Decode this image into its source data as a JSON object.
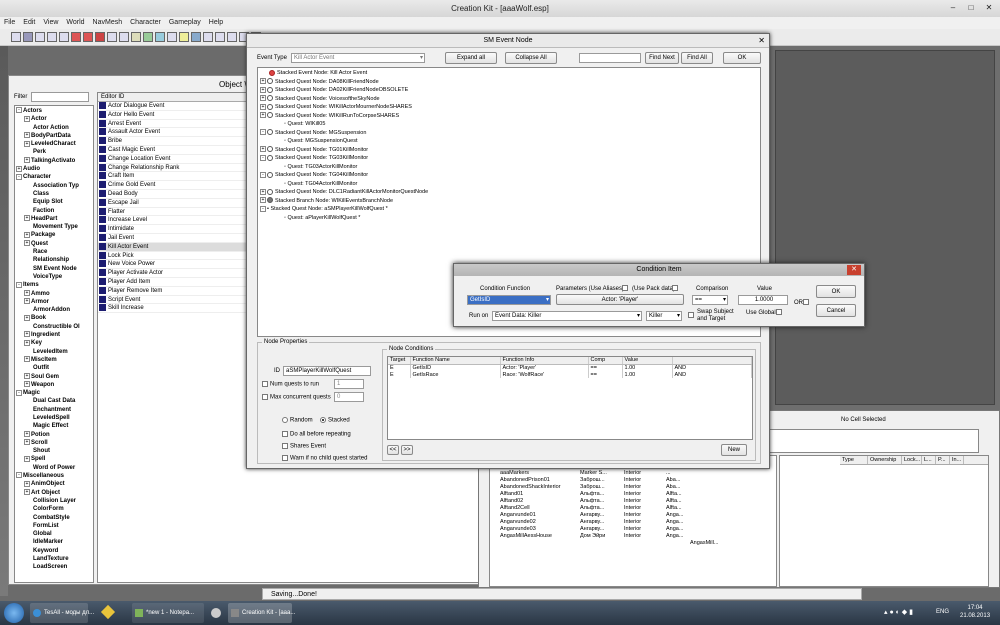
{
  "app": {
    "title": "Creation Kit - [aaaWolf.esp]"
  },
  "menu": [
    "File",
    "Edit",
    "View",
    "World",
    "NavMesh",
    "Character",
    "Gameplay",
    "Help"
  ],
  "object_window": {
    "title": "Object W",
    "filter_label": "Filter",
    "editor_id_header": "Editor ID",
    "tree": [
      {
        "label": "Actors",
        "exp": "-",
        "indent": 0,
        "bold": true
      },
      {
        "label": "Actor",
        "exp": "+",
        "indent": 1,
        "bold": true
      },
      {
        "label": "Actor Action",
        "exp": "",
        "indent": 1,
        "bold": true
      },
      {
        "label": "BodyPartData",
        "exp": "+",
        "indent": 1,
        "bold": true
      },
      {
        "label": "LeveledCharact",
        "exp": "+",
        "indent": 1,
        "bold": true
      },
      {
        "label": "Perk",
        "exp": "",
        "indent": 1,
        "bold": true
      },
      {
        "label": "TalkingActivato",
        "exp": "+",
        "indent": 1,
        "bold": true
      },
      {
        "label": "Audio",
        "exp": "+",
        "indent": 0,
        "bold": true
      },
      {
        "label": "Character",
        "exp": "-",
        "indent": 0,
        "bold": true
      },
      {
        "label": "Association Typ",
        "exp": "",
        "indent": 1,
        "bold": true
      },
      {
        "label": "Class",
        "exp": "",
        "indent": 1,
        "bold": true
      },
      {
        "label": "Equip Slot",
        "exp": "",
        "indent": 1,
        "bold": true
      },
      {
        "label": "Faction",
        "exp": "",
        "indent": 1,
        "bold": true
      },
      {
        "label": "HeadPart",
        "exp": "+",
        "indent": 1,
        "bold": true
      },
      {
        "label": "Movement Type",
        "exp": "",
        "indent": 1,
        "bold": true
      },
      {
        "label": "Package",
        "exp": "+",
        "indent": 1,
        "bold": true
      },
      {
        "label": "Quest",
        "exp": "+",
        "indent": 1,
        "bold": true
      },
      {
        "label": "Race",
        "exp": "",
        "indent": 1,
        "bold": true
      },
      {
        "label": "Relationship",
        "exp": "",
        "indent": 1,
        "bold": true
      },
      {
        "label": "SM Event Node",
        "exp": "",
        "indent": 1,
        "bold": true
      },
      {
        "label": "VoiceType",
        "exp": "",
        "indent": 1,
        "bold": true
      },
      {
        "label": "Items",
        "exp": "-",
        "indent": 0,
        "bold": true
      },
      {
        "label": "Ammo",
        "exp": "+",
        "indent": 1,
        "bold": true
      },
      {
        "label": "Armor",
        "exp": "+",
        "indent": 1,
        "bold": true
      },
      {
        "label": "ArmorAddon",
        "exp": "",
        "indent": 1,
        "bold": true
      },
      {
        "label": "Book",
        "exp": "+",
        "indent": 1,
        "bold": true
      },
      {
        "label": "Constructible Ol",
        "exp": "",
        "indent": 1,
        "bold": true
      },
      {
        "label": "Ingredient",
        "exp": "+",
        "indent": 1,
        "bold": true
      },
      {
        "label": "Key",
        "exp": "+",
        "indent": 1,
        "bold": true
      },
      {
        "label": "LeveledItem",
        "exp": "",
        "indent": 1,
        "bold": true
      },
      {
        "label": "MiscItem",
        "exp": "+",
        "indent": 1,
        "bold": true
      },
      {
        "label": "Outfit",
        "exp": "",
        "indent": 1,
        "bold": true
      },
      {
        "label": "Soul Gem",
        "exp": "+",
        "indent": 1,
        "bold": true
      },
      {
        "label": "Weapon",
        "exp": "+",
        "indent": 1,
        "bold": true
      },
      {
        "label": "Magic",
        "exp": "-",
        "indent": 0,
        "bold": true
      },
      {
        "label": "Dual Cast Data",
        "exp": "",
        "indent": 1,
        "bold": true
      },
      {
        "label": "Enchantment",
        "exp": "",
        "indent": 1,
        "bold": true
      },
      {
        "label": "LeveledSpell",
        "exp": "",
        "indent": 1,
        "bold": true
      },
      {
        "label": "Magic Effect",
        "exp": "",
        "indent": 1,
        "bold": true
      },
      {
        "label": "Potion",
        "exp": "+",
        "indent": 1,
        "bold": true
      },
      {
        "label": "Scroll",
        "exp": "+",
        "indent": 1,
        "bold": true
      },
      {
        "label": "Shout",
        "exp": "",
        "indent": 1,
        "bold": true
      },
      {
        "label": "Spell",
        "exp": "+",
        "indent": 1,
        "bold": true
      },
      {
        "label": "Word of Power",
        "exp": "",
        "indent": 1,
        "bold": true
      },
      {
        "label": "Miscellaneous",
        "exp": "-",
        "indent": 0,
        "bold": true
      },
      {
        "label": "AnimObject",
        "exp": "+",
        "indent": 1,
        "bold": true
      },
      {
        "label": "Art Object",
        "exp": "+",
        "indent": 1,
        "bold": true
      },
      {
        "label": "Collision Layer",
        "exp": "",
        "indent": 1,
        "bold": true
      },
      {
        "label": "ColorForm",
        "exp": "",
        "indent": 1,
        "bold": true
      },
      {
        "label": "CombatStyle",
        "exp": "",
        "indent": 1,
        "bold": true
      },
      {
        "label": "FormList",
        "exp": "",
        "indent": 1,
        "bold": true
      },
      {
        "label": "Global",
        "exp": "",
        "indent": 1,
        "bold": true
      },
      {
        "label": "IdleMarker",
        "exp": "",
        "indent": 1,
        "bold": true
      },
      {
        "label": "Keyword",
        "exp": "",
        "indent": 1,
        "bold": true
      },
      {
        "label": "LandTexture",
        "exp": "",
        "indent": 1,
        "bold": true
      },
      {
        "label": "LoadScreen",
        "exp": "",
        "indent": 1,
        "bold": true
      }
    ],
    "items": [
      "Actor Dialogue Event",
      "Actor Hello Event",
      "Arrest Event",
      "Assault Actor Event",
      "Bribe",
      "Cast Magic Event",
      "Change Location Event",
      "Change Relationship Rank",
      "Craft Item",
      "Crime Gold Event",
      "Dead Body",
      "Escape Jail",
      "Flatter",
      "Increase Level",
      "Intimidate",
      "Jail Event",
      "Kill Actor Event",
      "Lock Pick",
      "New Voice Power",
      "Player Activate Actor",
      "Player Add Item",
      "Player Remove Item",
      "Script Event",
      "Skill Increase"
    ],
    "selected_item": "Kill Actor Event"
  },
  "sm_event": {
    "title": "SM Event Node",
    "event_type_label": "Event Type",
    "event_type_value": "Kill Actor Event",
    "expand_all": "Expand all",
    "collapse_all": "Collapse All",
    "find_next": "Find Next",
    "find_all": "Find All",
    "ok": "OK",
    "tree": [
      {
        "text": "Stacked Event Node: Kill Actor Event",
        "indent": 0,
        "exp": "",
        "dot": "r"
      },
      {
        "text": "Stacked Quest Node: DA08KillFriendNode",
        "indent": 0,
        "exp": "+",
        "dot": ""
      },
      {
        "text": "Stacked Quest Node: DA02KillFriendNodeOBSOLETE",
        "indent": 0,
        "exp": "+",
        "dot": ""
      },
      {
        "text": "Stacked Quest Node: VoicesoftheSkyNode",
        "indent": 0,
        "exp": "+",
        "dot": ""
      },
      {
        "text": "Stacked Quest Node: WIKillActorMournerNodeSHARES",
        "indent": 0,
        "exp": "+",
        "dot": ""
      },
      {
        "text": "Stacked Quest Node: WIKillRunToCorpseSHARES",
        "indent": 0,
        "exp": "+",
        "dot": ""
      },
      {
        "text": "Quest: WIKill05",
        "indent": 2,
        "exp": "",
        "dot": "q"
      },
      {
        "text": "Stacked Quest Node: MGSuspension",
        "indent": 0,
        "exp": "-",
        "dot": ""
      },
      {
        "text": "Quest: MGSuspensionQuest",
        "indent": 2,
        "exp": "",
        "dot": "q"
      },
      {
        "text": "Stacked Quest Node: TG01KillMonitor",
        "indent": 0,
        "exp": "+",
        "dot": ""
      },
      {
        "text": "Stacked Quest Node: TG03KillMonitor",
        "indent": 0,
        "exp": "-",
        "dot": ""
      },
      {
        "text": "Quest: TG03ActorKillMonitor",
        "indent": 2,
        "exp": "",
        "dot": "q"
      },
      {
        "text": "Stacked Quest Node: TG04KillMonitor",
        "indent": 0,
        "exp": "-",
        "dot": ""
      },
      {
        "text": "Quest: TG04ActorKillMonitor",
        "indent": 2,
        "exp": "",
        "dot": "q"
      },
      {
        "text": "Stacked Quest Node: DLC1RadiantKillActorMonitorQuestNode",
        "indent": 0,
        "exp": "+",
        "dot": ""
      },
      {
        "text": "Stacked Branch Node: WIKillEventsBranchNode",
        "indent": 0,
        "exp": "+",
        "dot": "f"
      },
      {
        "text": "Stacked Quest Node: aSMPlayerKillWolfQuest *",
        "indent": 0,
        "exp": "-",
        "dot": "s"
      },
      {
        "text": "Quest: aPlayerKillWolfQuest *",
        "indent": 2,
        "exp": "",
        "dot": "q"
      }
    ],
    "node_properties": {
      "title": "Node Properties",
      "id_label": "ID",
      "id_value": "aSMPlayerKillWolfQuest",
      "num_quests_label": "Num quests to run",
      "num_quests_value": "1",
      "max_concurrent_label": "Max concurrent quests",
      "max_concurrent_value": "0",
      "random_label": "Random",
      "stacked_label": "Stacked",
      "do_all_label": "Do all before repeating",
      "shares_label": "Shares Event",
      "warn_label": "Warn if no child quest started"
    },
    "node_conditions": {
      "title": "Node Conditions",
      "headers": [
        "Target",
        "Function Name",
        "Function Info",
        "Comp",
        "Value",
        ""
      ],
      "rows": [
        [
          "E",
          "GetIsID",
          "Actor: 'Player'",
          "==",
          "1.00",
          "AND"
        ],
        [
          "E",
          "GetIsRace",
          "Race: 'WolfRace'",
          "==",
          "1.00",
          "AND"
        ]
      ],
      "prev": "<<",
      "next": ">>",
      "new": "New"
    }
  },
  "condition": {
    "title": "Condition Item",
    "condition_function_label": "Condition Function",
    "function_value": "GetIsID",
    "parameters_label": "Parameters  (Use Aliases)",
    "use_pack_label": "(Use Pack data)",
    "actor_button": "Actor: 'Player'",
    "comparison_label": "Comparison",
    "comparison_value": "==",
    "value_label": "Value",
    "value": "1.0000",
    "or_label": "OR",
    "run_on_label": "Run on",
    "run_on_value": "Event Data: Killer",
    "killer_value": "Killer",
    "swap_label": "Swap Subject\nand Target",
    "use_global_label": "Use Global",
    "ok": "OK",
    "cancel": "Cancel"
  },
  "cell_view": {
    "no_cell": "No Cell Selected",
    "headers": [
      "Type",
      "Ownership",
      "Lock...",
      "L...",
      "P...",
      "In..."
    ]
  },
  "cells": [
    [
      "aaaMarkers",
      "Marker S...",
      "Interior",
      "..."
    ],
    [
      "AbandonedPrison01",
      "Заброш...",
      "Interior",
      "Aba..."
    ],
    [
      "AbandonedShackInterior",
      "Заброш...",
      "Interior",
      "Aba..."
    ],
    [
      "Alftand01",
      "Альфта...",
      "Interior",
      "Alfta..."
    ],
    [
      "Alftand02",
      "Альфта...",
      "Interior",
      "Alfta..."
    ],
    [
      "Alftand2Cell",
      "Альфта...",
      "Interior",
      "Alfta..."
    ],
    [
      "Angarvunde01",
      "Ангарву...",
      "Interior",
      "Anga..."
    ],
    [
      "Angarvunde02",
      "Ангарву...",
      "Interior",
      "Anga..."
    ],
    [
      "Angarvunde03",
      "Ангарву...",
      "Interior",
      "Anga..."
    ],
    [
      "AngasMillAessHouse",
      "Дом Эйри",
      "Interior",
      "Anga..."
    ]
  ],
  "cell_extra": "AngasMill...",
  "status": {
    "text": "Saving...Done!"
  },
  "taskbar": {
    "items": [
      "TesAll - моды дл...",
      "",
      "*new 1 - Notepa...",
      "",
      "Creation Kit - [aaa..."
    ],
    "lang": "ENG",
    "time": "17:04",
    "date": "21.08.2013"
  }
}
